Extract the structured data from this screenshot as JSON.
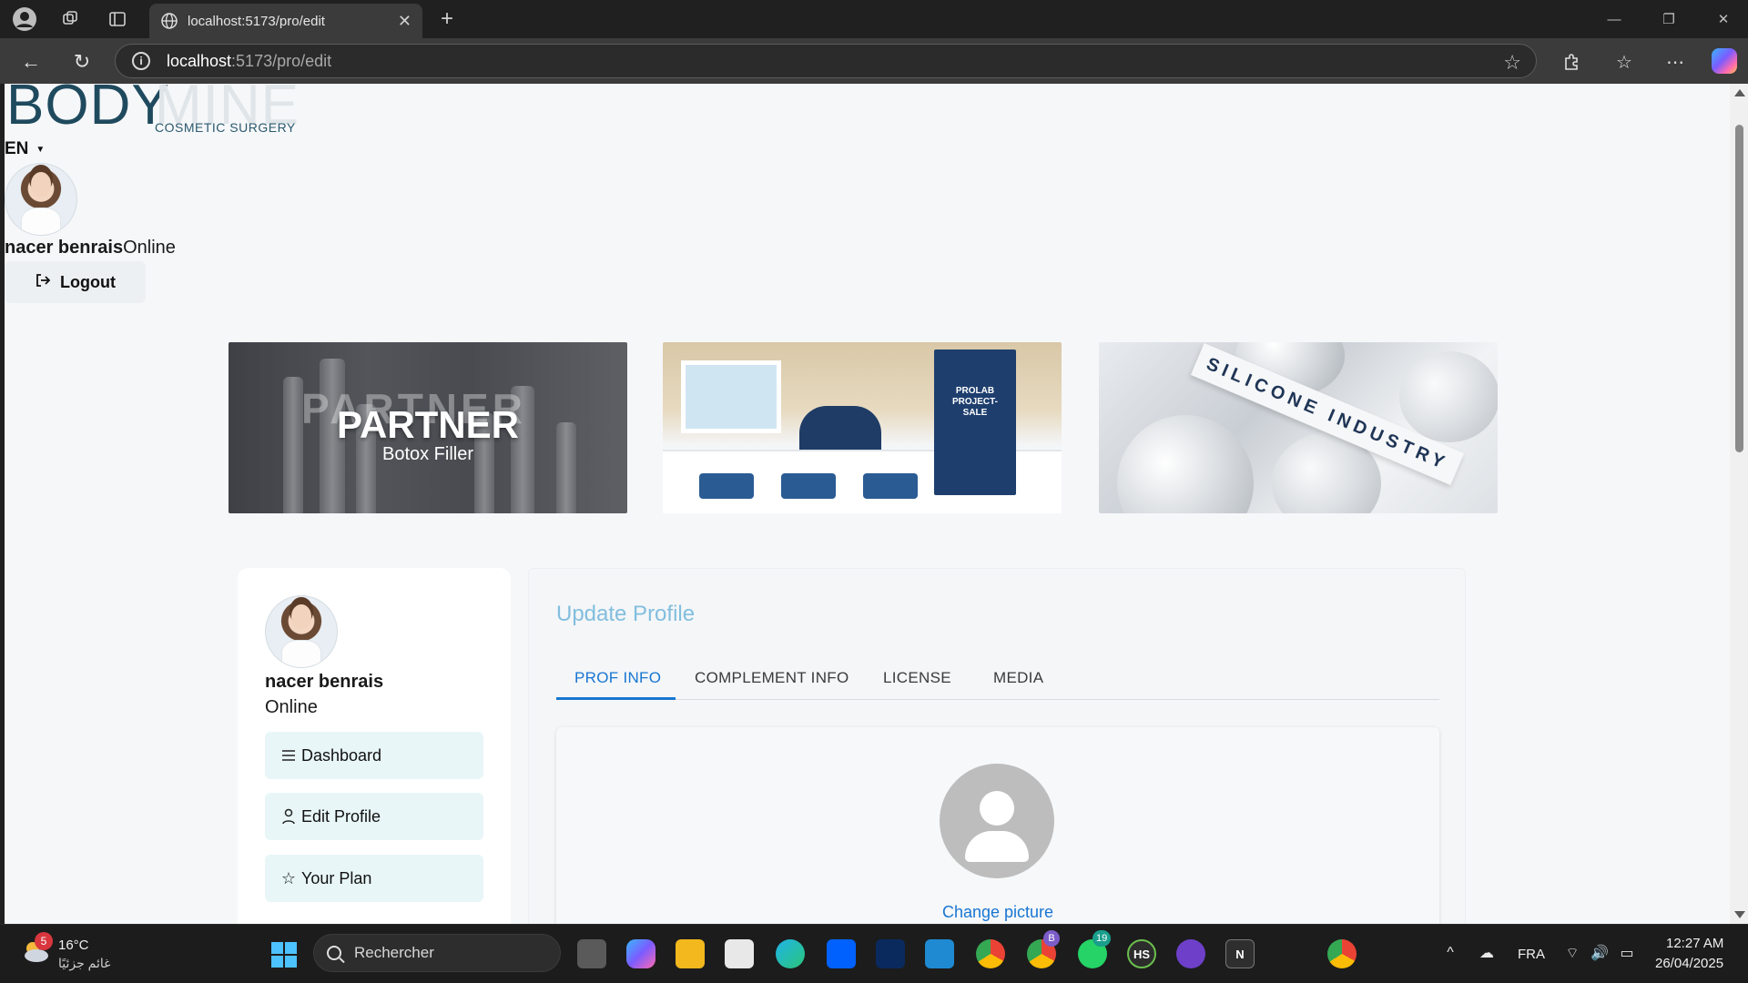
{
  "browser": {
    "tab_title": "localhost:5173/pro/edit",
    "url_host": "localhost",
    "url_path": ":5173/pro/edit"
  },
  "header": {
    "logo_primary": "BODY",
    "logo_secondary": "MINE",
    "logo_tagline": "COSMETIC SURGERY",
    "language": "EN",
    "user_name": "nacer benrais",
    "user_status": "Online",
    "logout_label": "Logout"
  },
  "banners": [
    {
      "title": "PARTNER",
      "subtitle": "Botox Filler",
      "ghost_text": "PARTNER"
    },
    {
      "sign_text": "PROLAB PROJECT-SALE"
    },
    {
      "plaque_text": "SILICONE INDUSTRY"
    }
  ],
  "sidebar": {
    "name": "nacer benrais",
    "status": "Online",
    "items": [
      {
        "label": "Dashboard",
        "icon": "menu-icon"
      },
      {
        "label": "Edit Profile",
        "icon": "user-icon"
      },
      {
        "label": "Your Plan",
        "icon": "star-icon"
      }
    ]
  },
  "main": {
    "title": "Update Profile",
    "tabs": [
      {
        "label": "PROF INFO",
        "active": true
      },
      {
        "label": "COMPLEMENT INFO",
        "active": false
      },
      {
        "label": "LICENSE",
        "active": false
      },
      {
        "label": "MEDIA",
        "active": false
      }
    ],
    "change_picture": "Change picture"
  },
  "taskbar": {
    "weather_temp": "16°C",
    "weather_desc": "غائم جزئيًا",
    "weather_badge": "5",
    "search_placeholder": "Rechercher",
    "badge_b": "B",
    "badge_whatsapp": "19",
    "hs_label": "HS",
    "notion_label": "N",
    "language": "FRA",
    "time": "12:27 AM",
    "date": "26/04/2025"
  },
  "colors": {
    "accent": "#1976d2",
    "title_blue": "#82bede",
    "sidebar_item_bg": "#e8f6f8"
  }
}
